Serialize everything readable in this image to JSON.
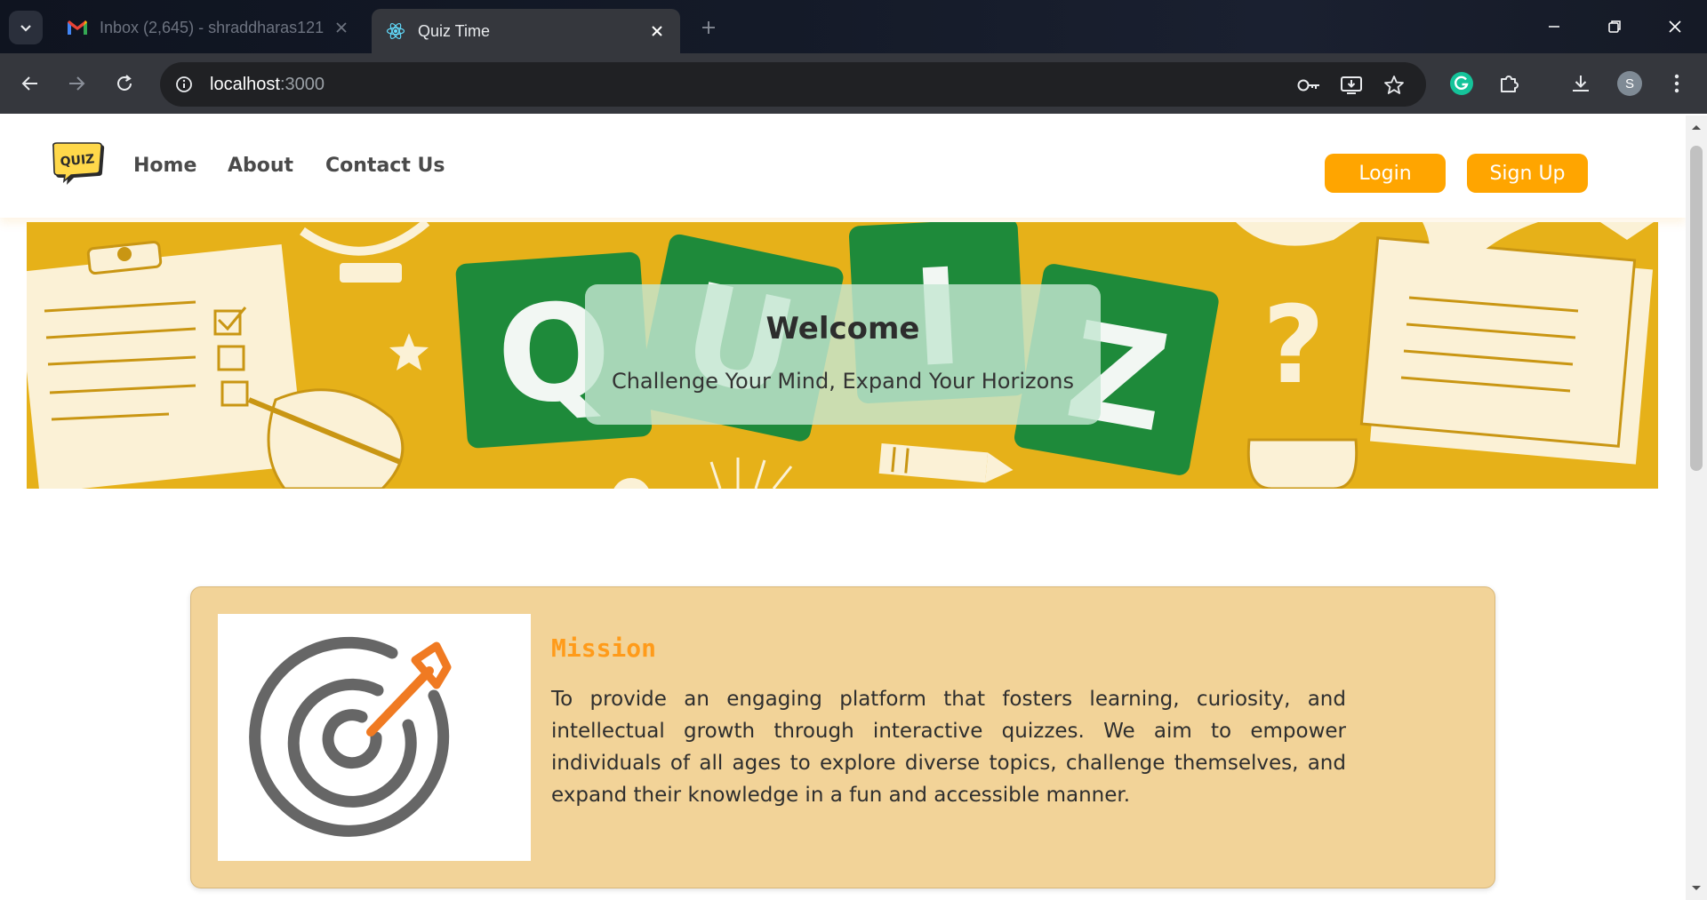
{
  "browser": {
    "tabs": [
      {
        "title": "Inbox (2,645) - shraddharas121",
        "active": false,
        "icon": "gmail-icon"
      },
      {
        "title": "Quiz Time",
        "active": true,
        "icon": "react-icon"
      }
    ],
    "address": {
      "host": "localhost",
      "port": ":3000"
    },
    "profile_initial": "S"
  },
  "site": {
    "logo_text": "QUIZ",
    "nav": {
      "home": "Home",
      "about": "About",
      "contact": "Contact Us"
    },
    "buttons": {
      "login": "Login",
      "signup": "Sign Up"
    },
    "hero": {
      "title": "Welcome",
      "subtitle": "Challenge Your Mind, Expand Your Horizons",
      "tiles": [
        "Q",
        "U",
        "I",
        "Z"
      ]
    },
    "mission": {
      "title": "Mission",
      "text": "To provide an engaging platform that fosters learning, curiosity, and intellectual growth through interactive quizzes. We aim to empower individuals of all ages to explore diverse topics, challenge themselves, and expand their knowledge in a fun and accessible manner."
    }
  },
  "colors": {
    "accent": "#ffa500",
    "hero_bg": "#e6b119",
    "tile_green": "#1e8a3a",
    "card_bg": "#f2d398",
    "mission_title": "#ff9b1a"
  }
}
